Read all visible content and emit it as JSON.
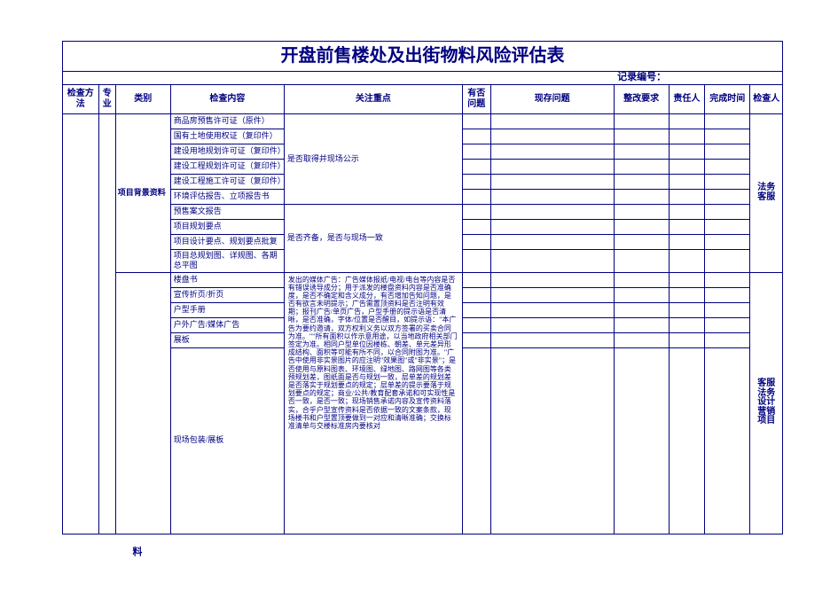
{
  "title": "开盘前售楼处及出街物料风险评估表",
  "record_label": "记录编号：",
  "headers": {
    "method": "检查方法",
    "specialty": "专业",
    "category": "类别",
    "content": "检查内容",
    "focus": "关注重点",
    "has_issue": "有否问题",
    "current_issue": "现存问题",
    "rectify": "整改要求",
    "responsible": "责任人",
    "complete_time": "完成时间",
    "reviewer": "检查人"
  },
  "group1": {
    "category": "项目背景资料",
    "items": [
      "商品房预售许可证（原件）",
      "国有土地使用权证（复印件）",
      "建设用地规划许可证（复印件）",
      "建设工程规划许可证（复印件）",
      "建设工程施工许可证（复印件）",
      "环境评估报告、立项报告书",
      "预售案文报告",
      "项目规划要点",
      "项目设计要点、规划要点批复",
      "项目总规划图、详规图、各期总平图"
    ],
    "focus_a": "是否取得并现场公示",
    "focus_b": "是否齐备，是否与现场一致",
    "reviewer": "法务\n客服"
  },
  "group2": {
    "items": [
      "楼盘书",
      "宣传折页/折页",
      "户型手册",
      "户外广告/媒体广告",
      "展板",
      "现场包装/展板"
    ],
    "focus": "发出的媒体广告：广告媒体报纸/电视/电台等内容是否有错误诱导成分；用于派发的楼盘资料内容是否准确度，是否不确定和含义成分，有否增加告知问题，是否有欲言未明提示；广告需置顶资料是否注明有效期；报刊广告/单页广告，户型手册的提示语是否清晰，是否准确，字体/位置是否醒目，如提示语：\"本广告为要约邀请，双方权利义务以双方签署的买卖合同为准。\"\"所有面积以作示意用途，以当地政府相关部门签定为准。相同户型单位因楼栋、朝差、单元差异形成结构、面积等可能有所不同，以合同附图为准。\"广告中使用非实景图片的应注明\"效果图\"或\"非实景\"；是否使用与原料图表、环境图、绿地图、路网图等各类预规划差，图纸面是否与规划一致，层单差的规划差是否落实于规划要点的规定；层单差的提示要落于规划要点的规定；商业/公共/教育配套承诺和可实现性是否一致，是否一致；现场销售承诺内容及宣传资料落实，合乎户型宣传资料是否依据一致的文案条款，现场楼书和户型置顶要做到一对应和清晰准确；交换标准清单与交楼标准房内要核对",
    "reviewer": "客服\n法务\n设计\n营销\n项目"
  },
  "below_left": "料"
}
